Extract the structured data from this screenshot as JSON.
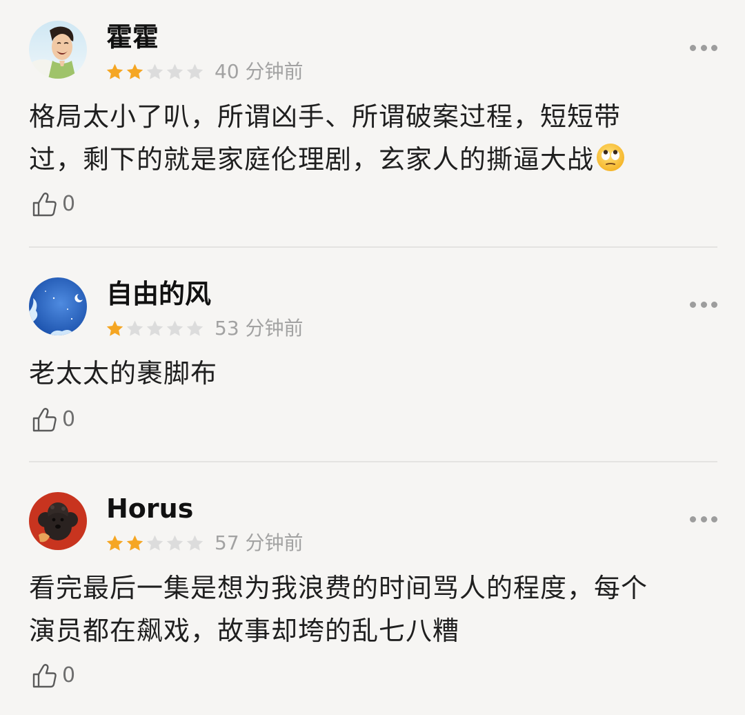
{
  "comments": [
    {
      "user_name": "霍霍",
      "avatar_icon": "avatar-laughing-man",
      "stars_filled": 2,
      "stars_total": 5,
      "time": "40 分钟前",
      "text_line1": "格局太小了叭，所谓凶手、所谓破案过程，短短带",
      "text_line2": "过，剩下的就是家庭伦理剧，玄家人的撕逼大战",
      "emoji_icon": "eye-roll-emoji",
      "like_count": "0"
    },
    {
      "user_name": "自由的风",
      "avatar_icon": "avatar-blue-moon-sky",
      "stars_filled": 1,
      "stars_total": 5,
      "time": "53 分钟前",
      "text_line1": "老太太的裹脚布",
      "like_count": "0"
    },
    {
      "user_name": "Horus",
      "avatar_icon": "avatar-black-poodle",
      "stars_filled": 2,
      "stars_total": 5,
      "time": "57 分钟前",
      "text_line1": "看完最后一集是想为我浪费的时间骂人的程度，每个",
      "text_line2": "演员都在飙戏，故事却垮的乱七八糟",
      "like_count": "0"
    }
  ],
  "colors": {
    "background": "#f6f5f3",
    "star_filled": "#f5a623",
    "star_empty": "#dcdcdc",
    "time_text": "#a2a2a2",
    "more_dots": "#9d9d9d",
    "divider": "#e4e3e1"
  }
}
